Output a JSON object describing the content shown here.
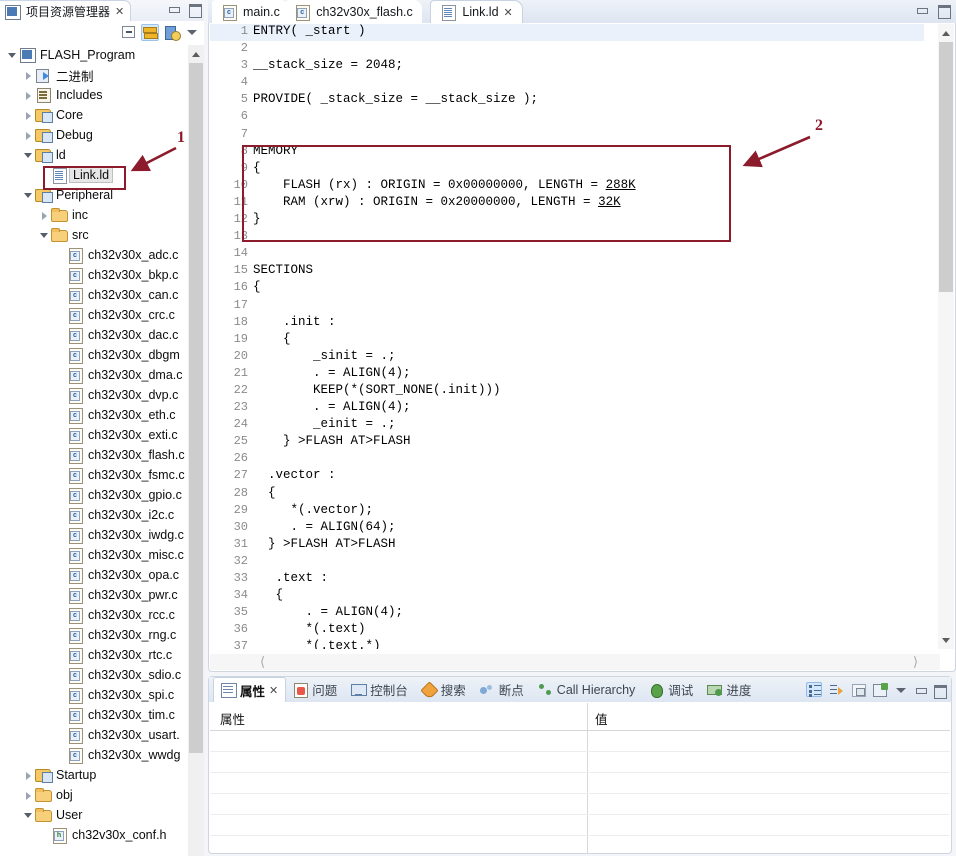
{
  "explorer": {
    "title": "项目资源管理器",
    "close_label": "✕",
    "toolbar": [
      {
        "name": "collapse-all-icon",
        "label": ""
      },
      {
        "name": "link-with-editor-icon",
        "label": ""
      },
      {
        "name": "view-menu-icon",
        "label": ""
      },
      {
        "name": "view-menu-chevron-icon",
        "label": ""
      }
    ],
    "tree": [
      {
        "label": "FLASH_Program",
        "indent": 0,
        "twisty": "open",
        "icon": "project-icon",
        "selected": false
      },
      {
        "label": "二进制",
        "indent": 1,
        "twisty": "closed",
        "icon": "binaries-icon",
        "selected": false
      },
      {
        "label": "Includes",
        "indent": 1,
        "twisty": "closed",
        "icon": "includes-icon",
        "selected": false
      },
      {
        "label": "Core",
        "indent": 1,
        "twisty": "closed",
        "icon": "source-folder-icon",
        "selected": false
      },
      {
        "label": "Debug",
        "indent": 1,
        "twisty": "closed",
        "icon": "source-folder-icon",
        "selected": false
      },
      {
        "label": "ld",
        "indent": 1,
        "twisty": "open",
        "icon": "source-folder-icon",
        "selected": false
      },
      {
        "label": "Link.ld",
        "indent": 2,
        "twisty": "none",
        "icon": "ld-file-icon",
        "selected": true
      },
      {
        "label": "Peripheral",
        "indent": 1,
        "twisty": "open",
        "icon": "source-folder-icon",
        "selected": false
      },
      {
        "label": "inc",
        "indent": 2,
        "twisty": "closed",
        "icon": "folder-icon",
        "selected": false
      },
      {
        "label": "src",
        "indent": 2,
        "twisty": "open",
        "icon": "folder-icon",
        "selected": false
      },
      {
        "label": "ch32v30x_adc.c",
        "indent": 3,
        "twisty": "none",
        "icon": "c-file-icon",
        "selected": false
      },
      {
        "label": "ch32v30x_bkp.c",
        "indent": 3,
        "twisty": "none",
        "icon": "c-file-icon",
        "selected": false
      },
      {
        "label": "ch32v30x_can.c",
        "indent": 3,
        "twisty": "none",
        "icon": "c-file-icon",
        "selected": false
      },
      {
        "label": "ch32v30x_crc.c",
        "indent": 3,
        "twisty": "none",
        "icon": "c-file-icon",
        "selected": false
      },
      {
        "label": "ch32v30x_dac.c",
        "indent": 3,
        "twisty": "none",
        "icon": "c-file-icon",
        "selected": false
      },
      {
        "label": "ch32v30x_dbgm",
        "indent": 3,
        "twisty": "none",
        "icon": "c-file-icon",
        "selected": false
      },
      {
        "label": "ch32v30x_dma.c",
        "indent": 3,
        "twisty": "none",
        "icon": "c-file-icon",
        "selected": false
      },
      {
        "label": "ch32v30x_dvp.c",
        "indent": 3,
        "twisty": "none",
        "icon": "c-file-icon",
        "selected": false
      },
      {
        "label": "ch32v30x_eth.c",
        "indent": 3,
        "twisty": "none",
        "icon": "c-file-icon",
        "selected": false
      },
      {
        "label": "ch32v30x_exti.c",
        "indent": 3,
        "twisty": "none",
        "icon": "c-file-icon",
        "selected": false
      },
      {
        "label": "ch32v30x_flash.c",
        "indent": 3,
        "twisty": "none",
        "icon": "c-file-icon",
        "selected": false
      },
      {
        "label": "ch32v30x_fsmc.c",
        "indent": 3,
        "twisty": "none",
        "icon": "c-file-icon",
        "selected": false
      },
      {
        "label": "ch32v30x_gpio.c",
        "indent": 3,
        "twisty": "none",
        "icon": "c-file-icon",
        "selected": false
      },
      {
        "label": "ch32v30x_i2c.c",
        "indent": 3,
        "twisty": "none",
        "icon": "c-file-icon",
        "selected": false
      },
      {
        "label": "ch32v30x_iwdg.c",
        "indent": 3,
        "twisty": "none",
        "icon": "c-file-icon",
        "selected": false
      },
      {
        "label": "ch32v30x_misc.c",
        "indent": 3,
        "twisty": "none",
        "icon": "c-file-icon",
        "selected": false
      },
      {
        "label": "ch32v30x_opa.c",
        "indent": 3,
        "twisty": "none",
        "icon": "c-file-icon",
        "selected": false
      },
      {
        "label": "ch32v30x_pwr.c",
        "indent": 3,
        "twisty": "none",
        "icon": "c-file-icon",
        "selected": false
      },
      {
        "label": "ch32v30x_rcc.c",
        "indent": 3,
        "twisty": "none",
        "icon": "c-file-icon",
        "selected": false
      },
      {
        "label": "ch32v30x_rng.c",
        "indent": 3,
        "twisty": "none",
        "icon": "c-file-icon",
        "selected": false
      },
      {
        "label": "ch32v30x_rtc.c",
        "indent": 3,
        "twisty": "none",
        "icon": "c-file-icon",
        "selected": false
      },
      {
        "label": "ch32v30x_sdio.c",
        "indent": 3,
        "twisty": "none",
        "icon": "c-file-icon",
        "selected": false
      },
      {
        "label": "ch32v30x_spi.c",
        "indent": 3,
        "twisty": "none",
        "icon": "c-file-icon",
        "selected": false
      },
      {
        "label": "ch32v30x_tim.c",
        "indent": 3,
        "twisty": "none",
        "icon": "c-file-icon",
        "selected": false
      },
      {
        "label": "ch32v30x_usart.",
        "indent": 3,
        "twisty": "none",
        "icon": "c-file-icon",
        "selected": false
      },
      {
        "label": "ch32v30x_wwdg",
        "indent": 3,
        "twisty": "none",
        "icon": "c-file-icon",
        "selected": false
      },
      {
        "label": "Startup",
        "indent": 1,
        "twisty": "closed",
        "icon": "source-folder-icon",
        "selected": false
      },
      {
        "label": "obj",
        "indent": 1,
        "twisty": "closed",
        "icon": "folder-icon",
        "selected": false
      },
      {
        "label": "User",
        "indent": 1,
        "twisty": "open",
        "icon": "folder-icon",
        "selected": false
      },
      {
        "label": "ch32v30x_conf.h",
        "indent": 2,
        "twisty": "none",
        "icon": "h-file-icon",
        "selected": false
      }
    ]
  },
  "editor": {
    "tabs": [
      {
        "label": "main.c",
        "icon": "c-file-icon",
        "active": false,
        "closable": false
      },
      {
        "label": "ch32v30x_flash.c",
        "icon": "c-file-icon",
        "active": false,
        "closable": false
      },
      {
        "label": "Link.ld",
        "icon": "ld-file-icon",
        "active": true,
        "closable": true
      }
    ],
    "close_label": "✕",
    "lines": [
      {
        "n": "1",
        "text": "ENTRY( _start )",
        "current": true
      },
      {
        "n": "2",
        "text": "",
        "current": false
      },
      {
        "n": "3",
        "text": "__stack_size = 2048;",
        "current": false
      },
      {
        "n": "4",
        "text": "",
        "current": false
      },
      {
        "n": "5",
        "text": "PROVIDE( _stack_size = __stack_size );",
        "current": false
      },
      {
        "n": "6",
        "text": "",
        "current": false
      },
      {
        "n": "7",
        "text": "",
        "current": false
      },
      {
        "n": "8",
        "text": "MEMORY",
        "current": false
      },
      {
        "n": "9",
        "text": "{",
        "current": false
      },
      {
        "n": "10",
        "text": "    FLASH (rx) : ORIGIN = 0x00000000, LENGTH = ",
        "current": false,
        "suffix": "288K",
        "underline": true
      },
      {
        "n": "11",
        "text": "    RAM (xrw) : ORIGIN = 0x20000000, LENGTH = ",
        "current": false,
        "suffix": "32K",
        "underline": true
      },
      {
        "n": "12",
        "text": "}",
        "current": false
      },
      {
        "n": "13",
        "text": "",
        "current": false
      },
      {
        "n": "14",
        "text": "",
        "current": false
      },
      {
        "n": "15",
        "text": "SECTIONS",
        "current": false
      },
      {
        "n": "16",
        "text": "{",
        "current": false
      },
      {
        "n": "17",
        "text": "",
        "current": false
      },
      {
        "n": "18",
        "text": "    .init :",
        "current": false
      },
      {
        "n": "19",
        "text": "    {",
        "current": false
      },
      {
        "n": "20",
        "text": "        _sinit = .;",
        "current": false
      },
      {
        "n": "21",
        "text": "        . = ALIGN(4);",
        "current": false
      },
      {
        "n": "22",
        "text": "        KEEP(*(SORT_NONE(.init)))",
        "current": false
      },
      {
        "n": "23",
        "text": "        . = ALIGN(4);",
        "current": false
      },
      {
        "n": "24",
        "text": "        _einit = .;",
        "current": false
      },
      {
        "n": "25",
        "text": "    } >FLASH AT>FLASH",
        "current": false
      },
      {
        "n": "26",
        "text": "",
        "current": false
      },
      {
        "n": "27",
        "text": "  .vector :",
        "current": false
      },
      {
        "n": "28",
        "text": "  {",
        "current": false
      },
      {
        "n": "29",
        "text": "     *(.vector);",
        "current": false
      },
      {
        "n": "30",
        "text": "     . = ALIGN(64);",
        "current": false
      },
      {
        "n": "31",
        "text": "  } >FLASH AT>FLASH",
        "current": false
      },
      {
        "n": "32",
        "text": "",
        "current": false
      },
      {
        "n": "33",
        "text": "   .text :",
        "current": false
      },
      {
        "n": "34",
        "text": "   {",
        "current": false
      },
      {
        "n": "35",
        "text": "       . = ALIGN(4);",
        "current": false
      },
      {
        "n": "36",
        "text": "       *(.text)",
        "current": false
      },
      {
        "n": "37",
        "text": "       *(.text.*)",
        "current": false
      }
    ]
  },
  "annotations": [
    {
      "number": "1",
      "color": "#8c1c2b",
      "target": "Link.ld tree item"
    },
    {
      "number": "2",
      "color": "#8c1c2b",
      "target": "MEMORY block"
    }
  ],
  "bottom_panel": {
    "tabs": [
      {
        "label": "属性",
        "icon": "properties-icon",
        "active": true,
        "closable": true
      },
      {
        "label": "问题",
        "icon": "problems-icon",
        "active": false,
        "closable": false
      },
      {
        "label": "控制台",
        "icon": "console-icon",
        "active": false,
        "closable": false
      },
      {
        "label": "搜索",
        "icon": "search-icon",
        "active": false,
        "closable": false
      },
      {
        "label": "断点",
        "icon": "breakpoints-icon",
        "active": false,
        "closable": false
      },
      {
        "label": "Call Hierarchy",
        "icon": "call-hierarchy-icon",
        "active": false,
        "closable": false
      },
      {
        "label": "调试",
        "icon": "debug-icon",
        "active": false,
        "closable": false
      },
      {
        "label": "进度",
        "icon": "progress-icon",
        "active": false,
        "closable": false
      }
    ],
    "close_label": "✕",
    "toolbar": [
      {
        "name": "show-categories-icon",
        "selected": true
      },
      {
        "name": "show-advanced-icon",
        "selected": false
      },
      {
        "name": "restore-default-icon",
        "selected": false
      },
      {
        "name": "new-property-icon",
        "selected": false
      },
      {
        "name": "view-menu-icon",
        "selected": false
      },
      {
        "name": "minimize-icon",
        "selected": false
      },
      {
        "name": "maximize-icon",
        "selected": false
      }
    ],
    "columns": [
      "属性",
      "值"
    ],
    "rows": [
      [
        " ",
        " "
      ],
      [
        " ",
        " "
      ],
      [
        " ",
        " "
      ],
      [
        " ",
        " "
      ],
      [
        " ",
        " "
      ],
      [
        " ",
        " "
      ]
    ]
  }
}
